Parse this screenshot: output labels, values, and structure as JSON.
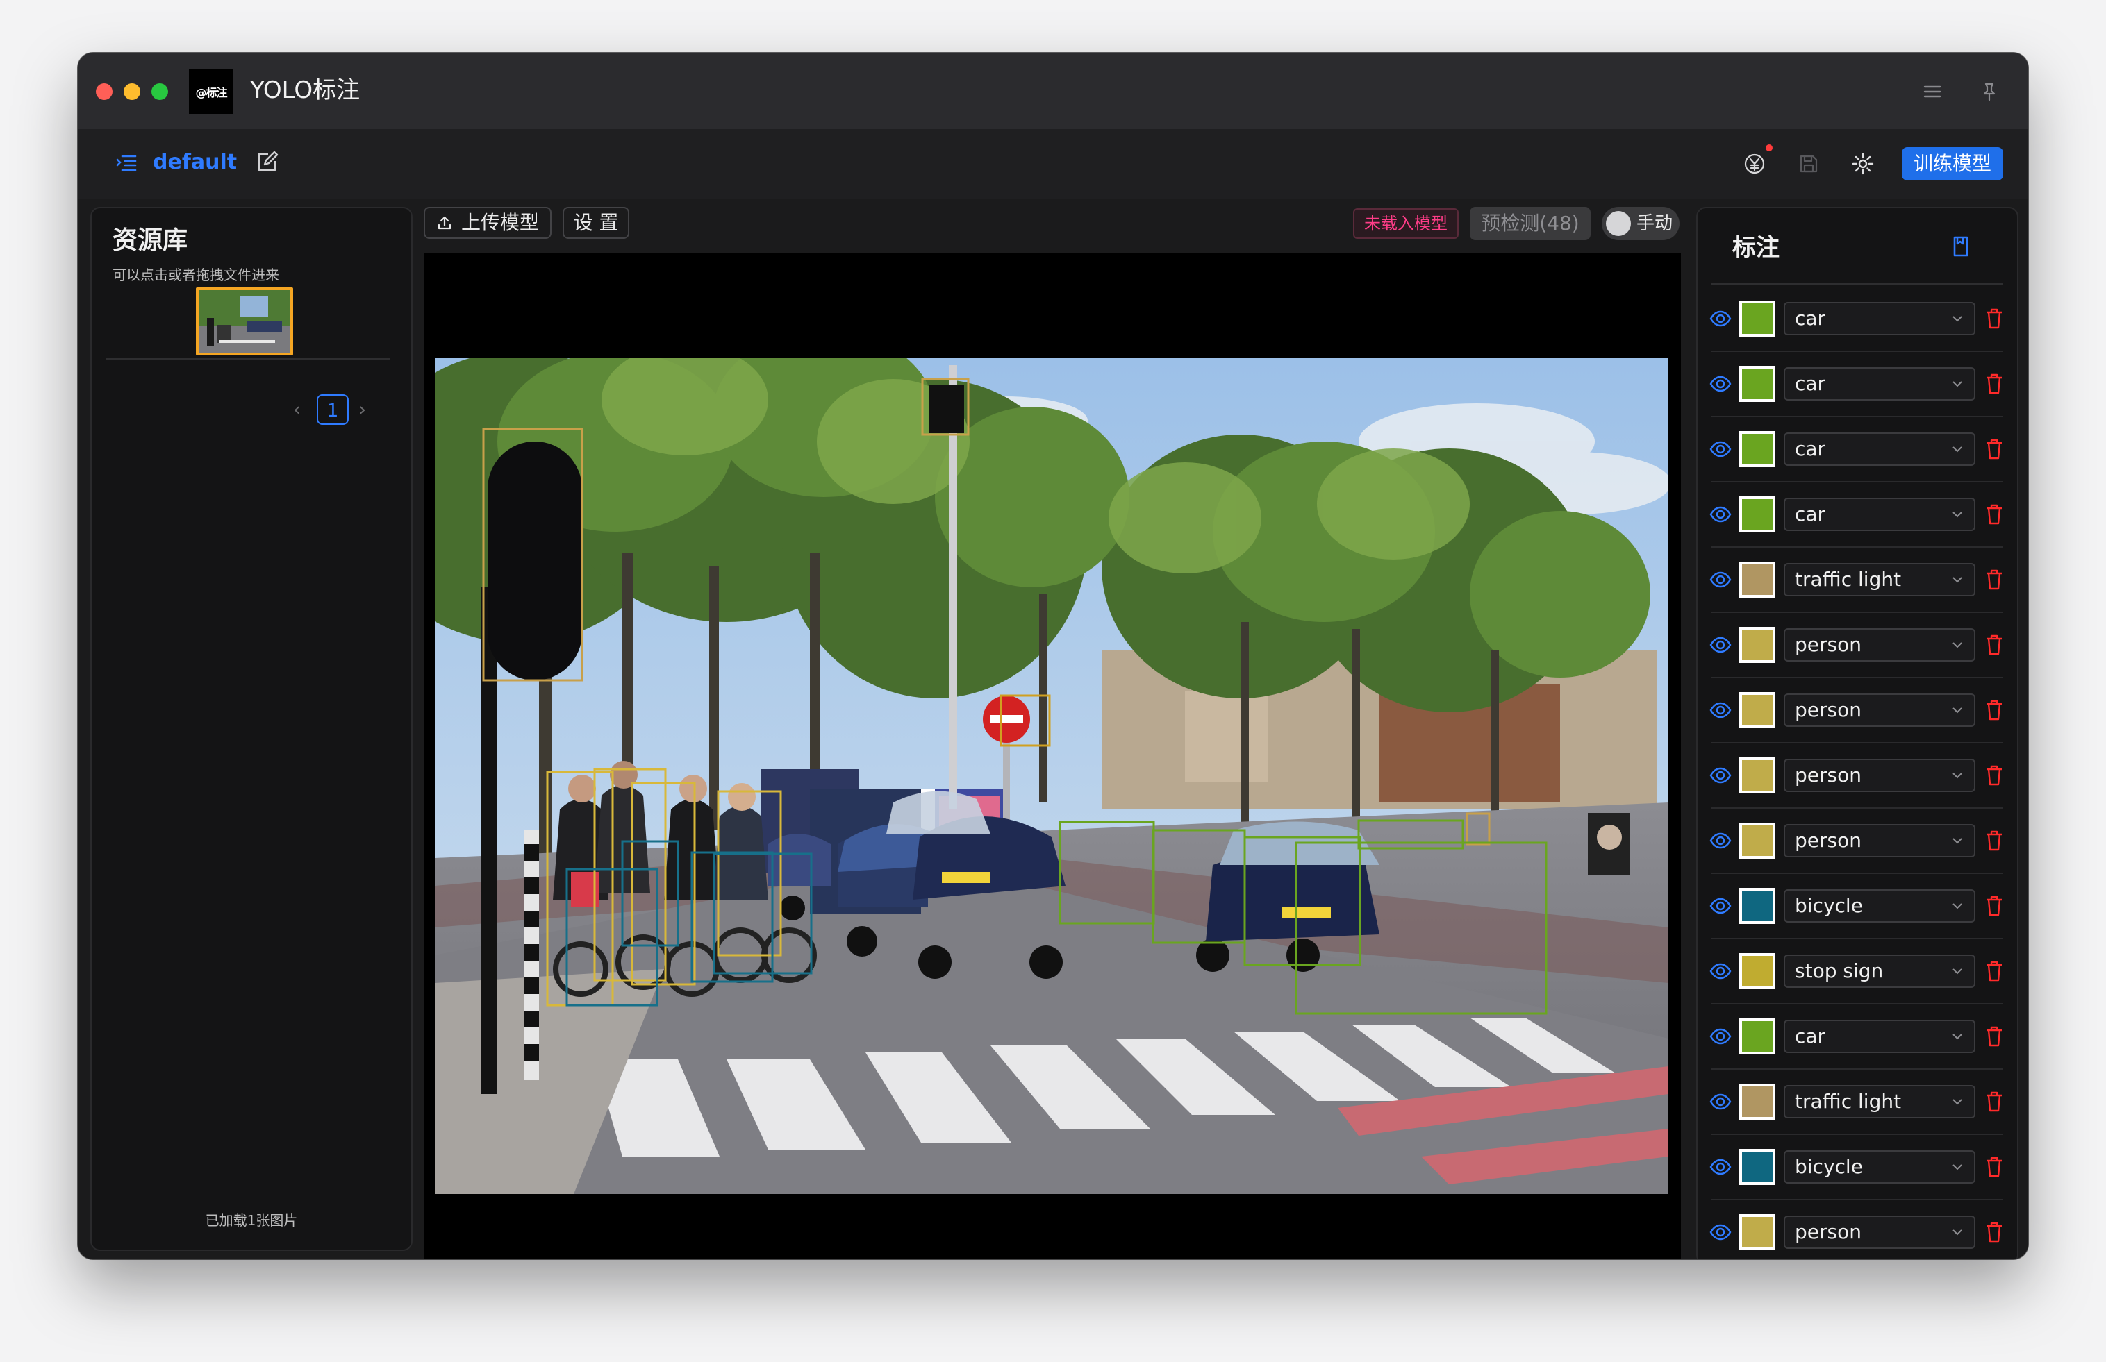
{
  "window": {
    "title": "YOLO标注",
    "logo_text": "@标注"
  },
  "toolbar": {
    "project_name": "default",
    "train_button": "训练模型"
  },
  "left_panel": {
    "title": "资源库",
    "subtitle": "可以点击或者拖拽文件进来",
    "current_page": "1",
    "footer": "已加载1张图片"
  },
  "center_toolbar": {
    "upload_model": "上传模型",
    "settings": "设 置",
    "model_status": "未载入模型",
    "predict_button": "预检测(48)",
    "mode_toggle_label": "手动"
  },
  "right_panel": {
    "title": "标注",
    "annotations": [
      {
        "label": "car",
        "color": "#6aa520"
      },
      {
        "label": "car",
        "color": "#6aa520"
      },
      {
        "label": "car",
        "color": "#6aa520"
      },
      {
        "label": "car",
        "color": "#6aa520"
      },
      {
        "label": "traffic light",
        "color": "#b09662"
      },
      {
        "label": "person",
        "color": "#c0ac4a"
      },
      {
        "label": "person",
        "color": "#c0ac4a"
      },
      {
        "label": "person",
        "color": "#c0ac4a"
      },
      {
        "label": "person",
        "color": "#c0ac4a"
      },
      {
        "label": "bicycle",
        "color": "#0f6780"
      },
      {
        "label": "stop sign",
        "color": "#c0ac30"
      },
      {
        "label": "car",
        "color": "#6aa520"
      },
      {
        "label": "traffic light",
        "color": "#b09662"
      },
      {
        "label": "bicycle",
        "color": "#0f6780"
      },
      {
        "label": "person",
        "color": "#c0ac4a"
      }
    ]
  },
  "colors": {
    "accent": "#1f6fea",
    "car_box": "#6aa520",
    "person_box": "#d8b83a",
    "bicycle_box": "#17708a",
    "traffic_light_box": "#c8a04a",
    "stop_sign_box": "#d0a020",
    "model_status": "#ff3d88"
  }
}
